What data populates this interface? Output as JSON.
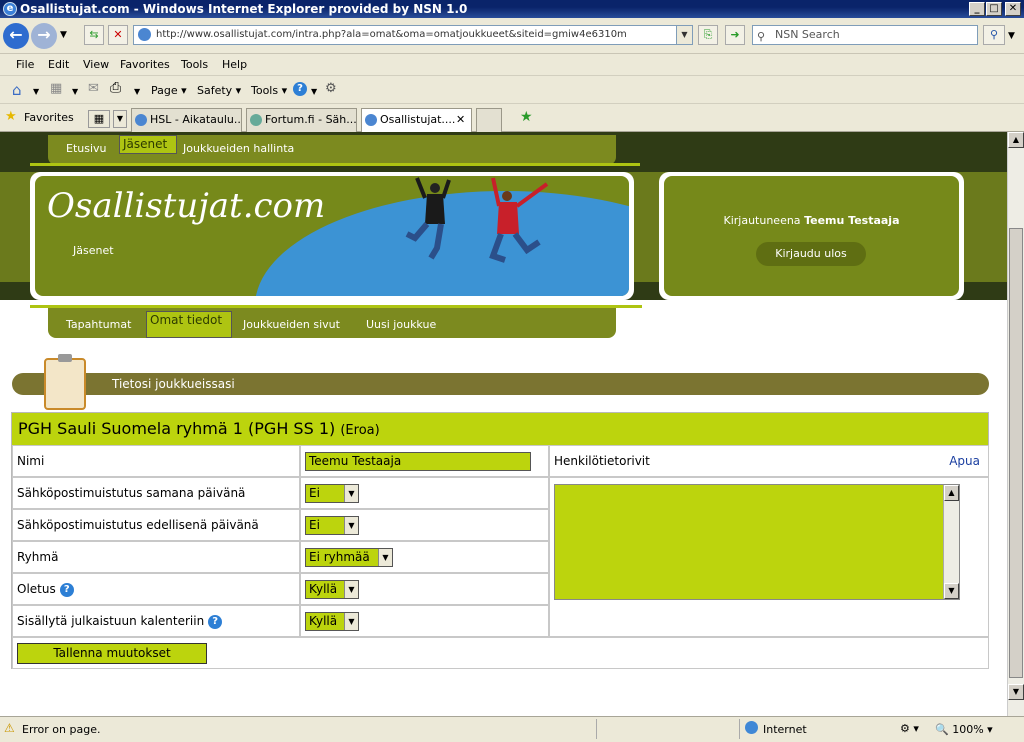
{
  "window": {
    "title": "Osallistujat.com - Windows Internet Explorer provided by NSN 1.0"
  },
  "address": {
    "url": "http://www.osallistujat.com/intra.php?ala=omat&oma=omatjoukkueet&siteid=gmiw4e6310m",
    "search_placeholder": "NSN Search"
  },
  "menu": [
    "File",
    "Edit",
    "View",
    "Favorites",
    "Tools",
    "Help"
  ],
  "commandbar": {
    "page": "Page",
    "safety": "Safety",
    "tools": "Tools"
  },
  "favorites": {
    "label": "Favorites"
  },
  "tabs": [
    {
      "label": "HSL - Aikataulu..."
    },
    {
      "label": "Fortum.fi - Säh..."
    },
    {
      "label": "Osallistujat...."
    }
  ],
  "site": {
    "top_nav": [
      "Etusivu",
      "Jäsenet",
      "Joukkueiden hallinta"
    ],
    "logo": "Osallistujat.com",
    "section_label": "Jäsenet",
    "login_prefix": "Kirjautuneena",
    "login_user": "Teemu Testaaja",
    "logout": "Kirjaudu ulos",
    "sub_nav": [
      "Tapahtumat",
      "Omat tiedot",
      "Joukkueiden sivut",
      "Uusi joukkue"
    ],
    "section_title": "Tietosi joukkueissasi"
  },
  "form": {
    "group_title": "PGH Sauli Suomela ryhmä 1 (PGH SS 1)",
    "leave": "(Eroa)",
    "rows": [
      {
        "label": "Nimi",
        "value": "Teemu Testaaja"
      },
      {
        "label": "Sähköpostimuistutus samana päivänä",
        "value": "Ei"
      },
      {
        "label": "Sähköpostimuistutus edellisenä päivänä",
        "value": "Ei"
      },
      {
        "label": "Ryhmä",
        "value": "Ei ryhmää"
      },
      {
        "label": "Oletus",
        "value": "Kyllä"
      },
      {
        "label": "Sisällytä julkaistuun kalenteriin",
        "value": "Kyllä"
      }
    ],
    "notes_label": "Henkilötietorivit",
    "help": "Apua",
    "save": "Tallenna muutokset"
  },
  "status": {
    "text": "Error on page.",
    "zone": "Internet",
    "zoom": "100%"
  },
  "colors": {
    "accent": "#bcd40d",
    "olive": "#76891a",
    "dark": "#2f3b15"
  }
}
